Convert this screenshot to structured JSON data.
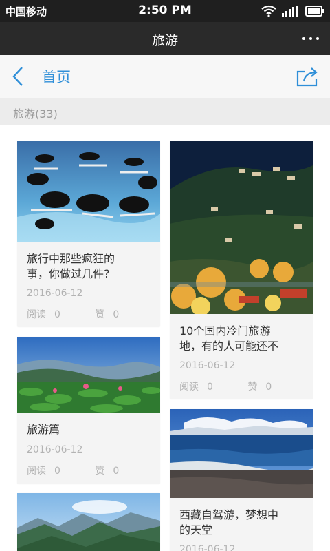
{
  "status_bar": {
    "carrier": "中国移动",
    "time": "2:50 PM",
    "icons": [
      "wifi-icon",
      "signal-icon",
      "battery-icon"
    ]
  },
  "title_bar": {
    "title": "旅游",
    "menu_icon": "more-icon"
  },
  "nav_bar": {
    "back_icon": "back-chevron-icon",
    "home_label": "首页",
    "share_icon": "share-icon",
    "accent_color": "#2f8fd8"
  },
  "category": {
    "label": "旅游(33)"
  },
  "cards": [
    {
      "title_line1": "旅行中那些疯狂的",
      "title_line2": "事，你做过几件?",
      "date": "2016-06-12",
      "read_label": "阅读",
      "read_count": "0",
      "like_label": "赞",
      "like_count": "0",
      "image": "skydiving-photo"
    },
    {
      "title_line1": "10个国内冷门旅游",
      "title_line2": "地，有的人可能还不",
      "date": "2016-06-12",
      "read_label": "阅读",
      "read_count": "0",
      "like_label": "赞",
      "like_count": "0",
      "image": "autumn-village-photo"
    },
    {
      "title_line1": "旅游篇",
      "date": "2016-06-12",
      "read_label": "阅读",
      "read_count": "0",
      "like_label": "赞",
      "like_count": "0",
      "image": "lotus-lake-photo"
    },
    {
      "title_line1": "西藏自驾游，梦想中",
      "title_line2": "的天堂",
      "date": "2016-06-12",
      "image": "tibet-lake-photo"
    },
    {
      "image": "mountain-valley-photo"
    }
  ]
}
